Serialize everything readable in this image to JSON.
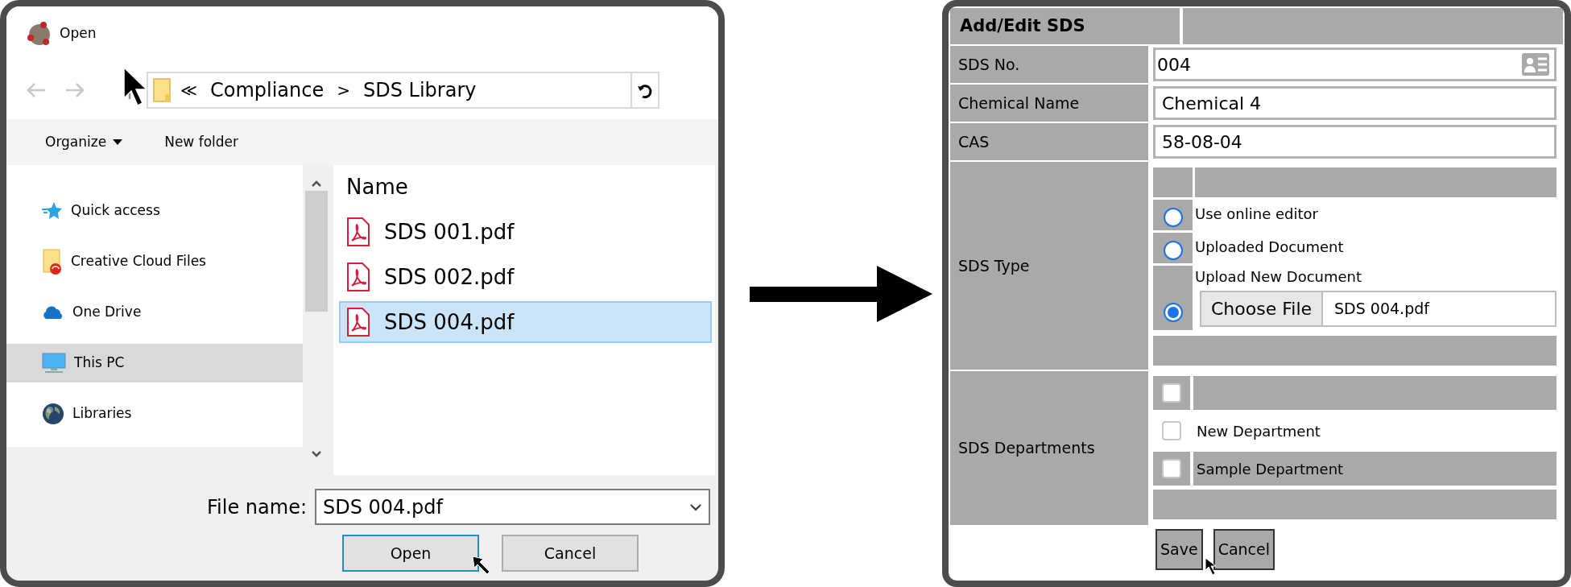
{
  "open_dialog": {
    "title": "Open",
    "address_bar": {
      "overflow": "≪",
      "separator": ">",
      "path": [
        "Compliance",
        "SDS Library"
      ]
    },
    "toolbar": [
      {
        "kind": "menu",
        "label": "Organize"
      },
      {
        "kind": "button",
        "label": "New folder"
      }
    ],
    "nav_items": [
      {
        "kind": "quick_access",
        "label": "Quick access",
        "selected": false
      },
      {
        "kind": "cloud_folder",
        "label": "Creative Cloud Files",
        "selected": false
      },
      {
        "kind": "onedrive",
        "label": "One Drive",
        "selected": false
      },
      {
        "kind": "pc",
        "label": "This PC",
        "selected": true
      },
      {
        "kind": "libraries",
        "label": "Libraries",
        "selected": false
      }
    ],
    "file_list": {
      "column": "Name",
      "files": [
        {
          "name": "SDS 001.pdf",
          "selected": false
        },
        {
          "name": "SDS 002.pdf",
          "selected": false
        },
        {
          "name": "SDS 004.pdf",
          "selected": true
        }
      ]
    },
    "file_name": {
      "label": "File name:",
      "value": "SDS 004.pdf"
    },
    "buttons": [
      {
        "label": "Open",
        "focused": true
      },
      {
        "label": "Cancel",
        "focused": false
      }
    ]
  },
  "sds_form": {
    "title": "Add/Edit SDS",
    "fields": [
      {
        "kind": "lookup",
        "label": "SDS No.",
        "value": "004"
      },
      {
        "kind": "text",
        "label": "Chemical Name",
        "value": "Chemical 4"
      },
      {
        "kind": "text",
        "label": "CAS",
        "value": "58-08-04"
      }
    ],
    "sds_type": {
      "label": "SDS Type",
      "options": [
        {
          "kind": "plain",
          "label": "Use online editor",
          "selected": false
        },
        {
          "kind": "plain",
          "label": "Uploaded Document",
          "selected": false
        },
        {
          "kind": "file",
          "label": "Upload New Document",
          "selected": true,
          "file_button": "Choose File",
          "file_name": "SDS 004.pdf"
        }
      ]
    },
    "departments": {
      "label": "SDS Departments",
      "items": [
        {
          "kind": "header",
          "checked": false
        },
        {
          "kind": "row",
          "label": "New Department",
          "checked": false
        },
        {
          "kind": "row",
          "label": "Sample Department",
          "checked": false
        }
      ]
    },
    "buttons": [
      "Save",
      "Cancel"
    ]
  }
}
